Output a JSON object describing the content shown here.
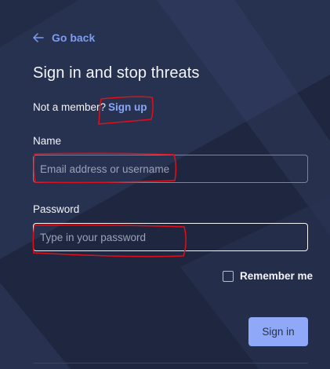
{
  "nav": {
    "back_label": "Go back"
  },
  "page": {
    "title": "Sign in and stop threats"
  },
  "signup": {
    "prompt": "Not a member?",
    "link_label": "Sign up"
  },
  "form": {
    "name_label": "Name",
    "name_placeholder": "Email address or username",
    "password_label": "Password",
    "password_placeholder": "Type in your password",
    "remember_label": "Remember me",
    "remember_checked": false,
    "submit_label": "Sign in"
  },
  "colors": {
    "background": "#1f2740",
    "link": "#8aa6f6",
    "button": "#8fa8f8",
    "annotation": "#e0101a"
  }
}
